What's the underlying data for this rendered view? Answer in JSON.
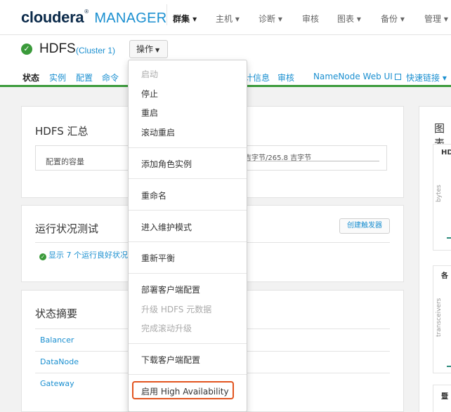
{
  "brand": {
    "name": "cloudera",
    "suffix": "MANAGER",
    "reg": "®"
  },
  "top_nav": {
    "items": [
      {
        "label": "群集 ▾",
        "active": true
      },
      {
        "label": "主机 ▾"
      },
      {
        "label": "诊断 ▾"
      },
      {
        "label": "审核"
      },
      {
        "label": "图表 ▾"
      },
      {
        "label": "备份 ▾"
      },
      {
        "label": "管理 ▾"
      }
    ]
  },
  "service": {
    "name": "HDFS",
    "cluster": "(Cluster 1)",
    "actions_label": "操作",
    "status_icon": "check-circle",
    "status_color": "#3a9a3a"
  },
  "sub_tabs": [
    "状态",
    "实例",
    "配置",
    "命令",
    "计信息",
    "审核",
    "NameNode Web UI",
    "快速链接 ▾"
  ],
  "summary_panel": {
    "title": "HDFS 汇总",
    "capacity_label": "配置的容量",
    "capacity_value": "吉字节/265.8 吉字节"
  },
  "health_panel": {
    "title": "运行状况测试",
    "create_trigger": "创建触发器",
    "health_text": "显示 7 个运行良好状况"
  },
  "status_summary": {
    "title": "状态摘要",
    "items": [
      "Balancer",
      "DataNode",
      "Gateway"
    ]
  },
  "charts": {
    "title": "图表",
    "chart1_label": "HD",
    "chart1_axis": "bytes",
    "chart2_label": "各",
    "chart2_axis": "transceivers",
    "chart3_label": "暨"
  },
  "actions_menu": {
    "items": [
      {
        "label": "启动",
        "disabled": true
      },
      {
        "label": "停止"
      },
      {
        "label": "重启"
      },
      {
        "label": "滚动重启"
      },
      {
        "label": "添加角色实例"
      },
      {
        "label": "重命名"
      },
      {
        "label": "进入维护模式"
      },
      {
        "label": "重新平衡"
      },
      {
        "label": "部署客户端配置"
      },
      {
        "label": "升级 HDFS 元数据",
        "disabled": true
      },
      {
        "label": "完成滚动升级",
        "disabled": true
      },
      {
        "label": "下载客户端配置"
      },
      {
        "label": "启用 High Availability",
        "highlighted": true
      }
    ],
    "highlight_color": "#e2541f"
  }
}
